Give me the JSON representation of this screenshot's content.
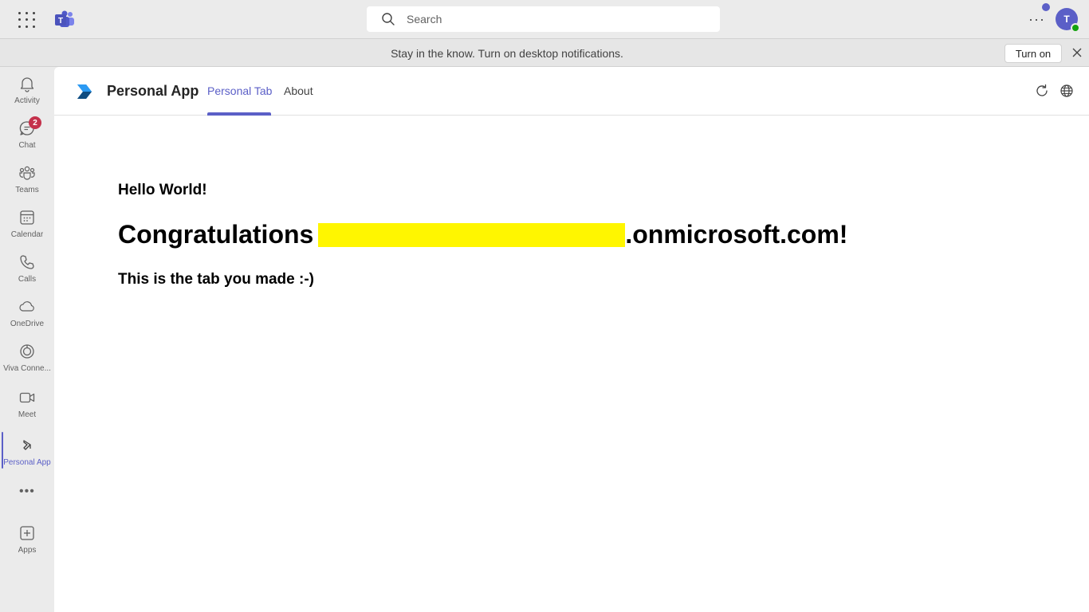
{
  "topbar": {
    "search_placeholder": "Search",
    "more_label": "···",
    "avatar_initial": "T"
  },
  "banner": {
    "text": "Stay in the know. Turn on desktop notifications.",
    "button_label": "Turn on"
  },
  "rail": {
    "items": [
      {
        "label": "Activity",
        "icon": "bell-icon"
      },
      {
        "label": "Chat",
        "icon": "chat-icon",
        "badge": "2"
      },
      {
        "label": "Teams",
        "icon": "teams-icon"
      },
      {
        "label": "Calendar",
        "icon": "calendar-icon"
      },
      {
        "label": "Calls",
        "icon": "phone-icon"
      },
      {
        "label": "OneDrive",
        "icon": "cloud-icon"
      },
      {
        "label": "Viva Conne...",
        "icon": "viva-connections-icon"
      },
      {
        "label": "Meet",
        "icon": "video-icon"
      },
      {
        "label": "Personal App",
        "icon": "personal-app-icon",
        "active": true
      },
      {
        "label": "Apps",
        "icon": "add-apps-icon"
      }
    ],
    "more_label": "•••"
  },
  "app": {
    "title": "Personal App",
    "tabs": [
      {
        "label": "Personal Tab",
        "active": true
      },
      {
        "label": "About",
        "active": false
      }
    ]
  },
  "content": {
    "hello": "Hello World!",
    "congrats_prefix": "Congratulations",
    "congrats_suffix": ".onmicrosoft.com!",
    "tab_message": "This is the tab you made :-)"
  },
  "colors": {
    "accent": "#5b5fc7",
    "redaction": "#fff600",
    "badge": "#c4314b",
    "presence": "#13a10e"
  }
}
